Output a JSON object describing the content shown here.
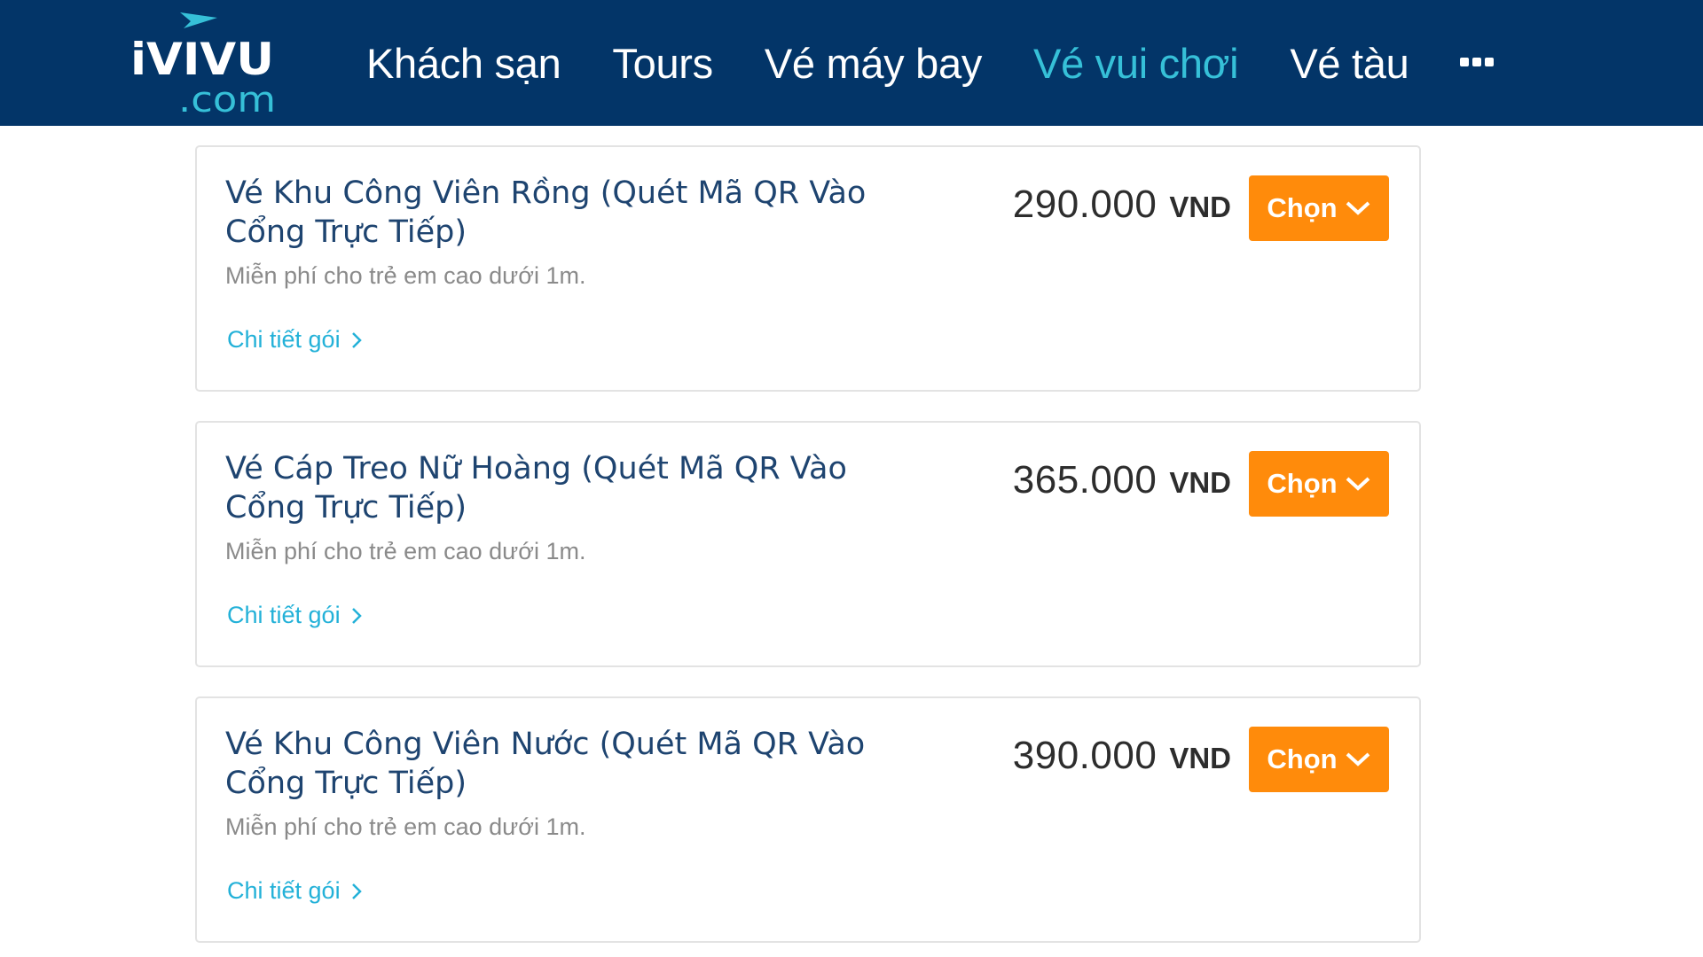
{
  "logo": {
    "text_top": "iVIVU",
    "text_bottom": ".com"
  },
  "nav": {
    "items": [
      {
        "label": "Khách sạn",
        "active": false
      },
      {
        "label": "Tours",
        "active": false
      },
      {
        "label": "Vé máy bay",
        "active": false
      },
      {
        "label": "Vé vui chơi",
        "active": true
      },
      {
        "label": "Vé tàu",
        "active": false
      }
    ],
    "more_icon": "more-dots-icon"
  },
  "tickets": [
    {
      "title": "Vé Khu Công Viên Rồng (Quét Mã QR Vào Cổng Trực Tiếp)",
      "description": "Miễn phí cho trẻ em cao dưới 1m.",
      "detail_label": "Chi tiết gói",
      "price": "290.000",
      "currency": "VND",
      "button_label": "Chọn"
    },
    {
      "title": "Vé Cáp Treo Nữ Hoàng (Quét Mã QR Vào Cổng Trực Tiếp)",
      "description": "Miễn phí cho trẻ em cao dưới 1m.",
      "detail_label": "Chi tiết gói",
      "price": "365.000",
      "currency": "VND",
      "button_label": "Chọn"
    },
    {
      "title": "Vé Khu Công Viên Nước (Quét Mã QR Vào Cổng Trực Tiếp)",
      "description": "Miễn phí cho trẻ em cao dưới 1m.",
      "detail_label": "Chi tiết gói",
      "price": "390.000",
      "currency": "VND",
      "button_label": "Chọn"
    }
  ],
  "colors": {
    "header_bg": "#033568",
    "nav_active": "#36c0d8",
    "title_text": "#1e4470",
    "link": "#23b1d8",
    "button_bg": "#ff8b0b",
    "price_text": "#2d2d2d"
  }
}
